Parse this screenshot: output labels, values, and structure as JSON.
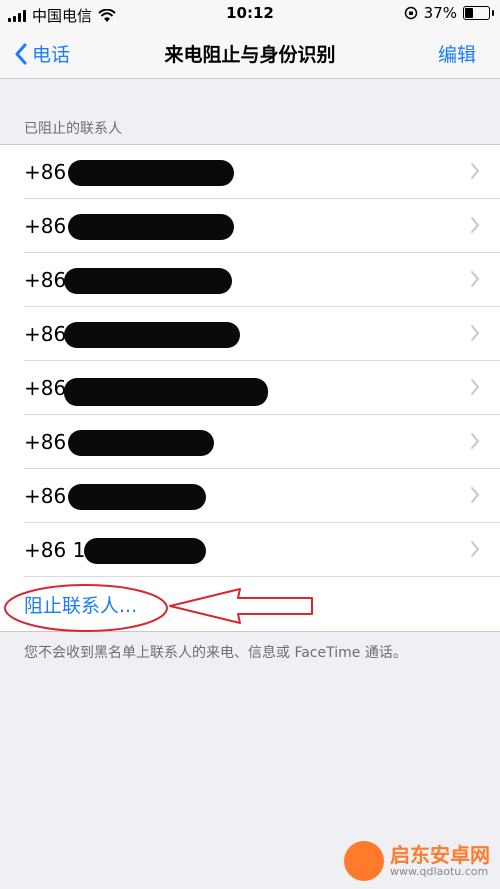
{
  "status_bar": {
    "carrier": "中国电信",
    "time": "10:12",
    "battery": "37%",
    "battery_level": 0.37
  },
  "nav": {
    "back_label": "电话",
    "title": "来电阻止与身份识别",
    "edit_label": "编辑"
  },
  "section_header": "已阻止的联系人",
  "blocked_contacts": [
    {
      "prefix": "+86"
    },
    {
      "prefix": "+86"
    },
    {
      "prefix": "+86"
    },
    {
      "prefix": "+86"
    },
    {
      "prefix": "+86"
    },
    {
      "prefix": "+86"
    },
    {
      "prefix": "+86"
    },
    {
      "prefix": "+86 1"
    }
  ],
  "block_contact_label": "阻止联系人...",
  "footer_note": "您不会收到黑名单上联系人的来电、信息或 FaceTime 通话。",
  "watermark": {
    "site_name": "启东安卓网",
    "url": "www.qdlaotu.com"
  },
  "colors": {
    "accent": "#1a7dfa",
    "annotation": "#d8282e",
    "background": "#efeff4"
  }
}
